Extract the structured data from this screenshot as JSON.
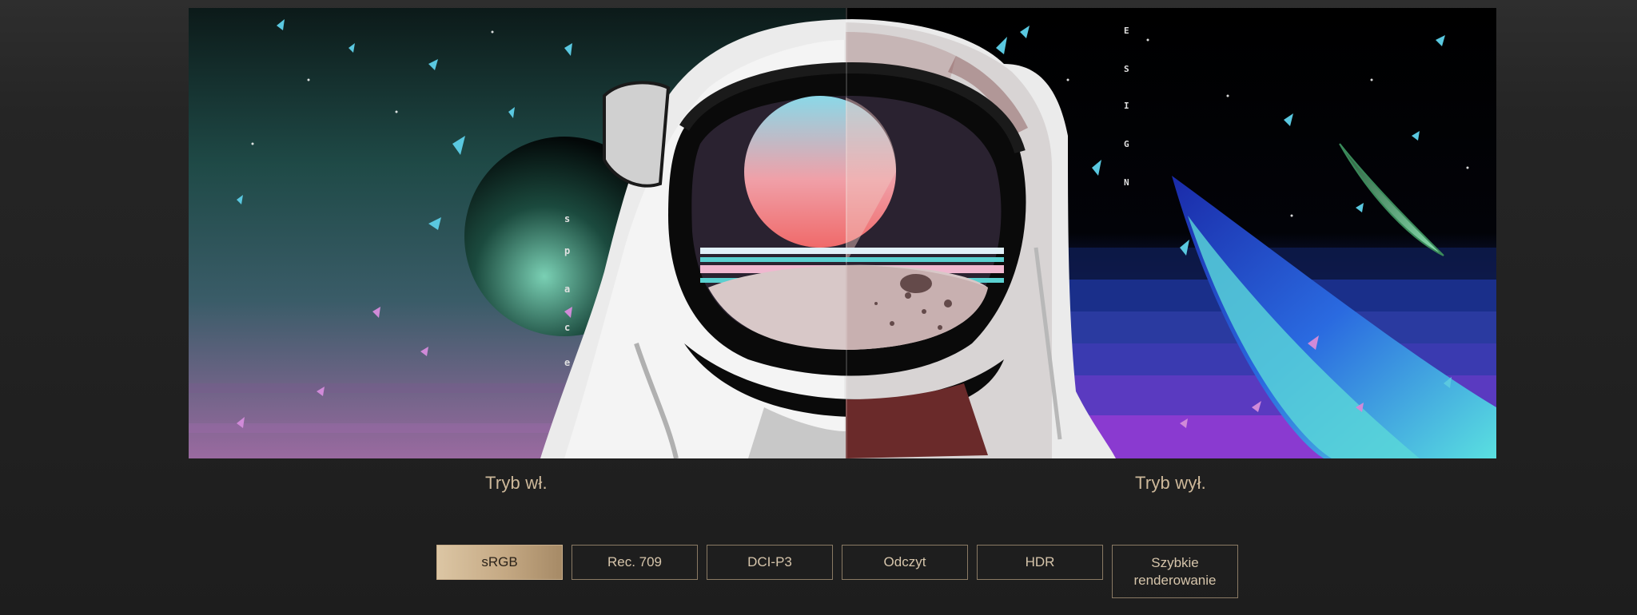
{
  "comparison": {
    "on_label": "Tryb wł.",
    "off_label": "Tryb wył.",
    "artwork_letters_left": [
      "s",
      "p",
      "a",
      "c",
      "e"
    ],
    "artwork_letters_right": [
      "E",
      "S",
      "I",
      "G",
      "N"
    ]
  },
  "modes": {
    "items": [
      {
        "id": "srgb",
        "label": "sRGB",
        "active": true
      },
      {
        "id": "rec709",
        "label": "Rec. 709",
        "active": false
      },
      {
        "id": "dcip3",
        "label": "DCI-P3",
        "active": false
      },
      {
        "id": "odczyt",
        "label": "Odczyt",
        "active": false
      },
      {
        "id": "hdr",
        "label": "HDR",
        "active": false
      },
      {
        "id": "szybkie",
        "label": "Szybkie renderowanie",
        "active": false
      }
    ]
  },
  "colors": {
    "accent_gold": "#c4a883",
    "label_text": "#cdb89a",
    "border": "#8a7a64",
    "background": "#1d1d1d"
  }
}
